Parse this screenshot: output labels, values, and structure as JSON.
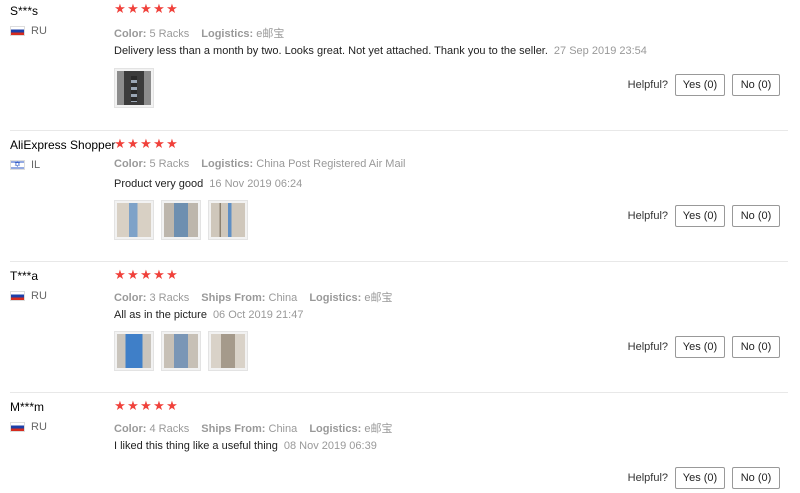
{
  "helpful_label": "Helpful?",
  "yes_label": "Yes (0)",
  "no_label": "No (0)",
  "star_glyph": "★",
  "rating_color": "#f0413b",
  "reviews": [
    {
      "name": "S***s",
      "country": "RU",
      "flag": "russia-flag",
      "stars": 5,
      "attributes": [
        {
          "key": "Color:",
          "value": "5 Racks"
        },
        {
          "key": "Logistics:",
          "value": "e邮宝"
        }
      ],
      "text": "Delivery less than a month by two. Looks great. Not yet attached. Thank you to the seller.",
      "date": "27 Sep 2019 23:54",
      "photo_count": 1
    },
    {
      "name": "AliExpress Shopper",
      "country": "IL",
      "flag": "israel-flag",
      "stars": 5,
      "attributes": [
        {
          "key": "Color:",
          "value": "5 Racks"
        },
        {
          "key": "Logistics:",
          "value": "China Post Registered Air Mail"
        }
      ],
      "text": "Product very good",
      "date": "16 Nov 2019 06:24",
      "photo_count": 3
    },
    {
      "name": "T***a",
      "country": "RU",
      "flag": "russia-flag",
      "stars": 5,
      "attributes": [
        {
          "key": "Color:",
          "value": "3 Racks"
        },
        {
          "key": "Ships From:",
          "value": "China"
        },
        {
          "key": "Logistics:",
          "value": "e邮宝"
        }
      ],
      "text": "All as in the picture",
      "date": "06 Oct 2019 21:47",
      "photo_count": 3
    },
    {
      "name": "M***m",
      "country": "RU",
      "flag": "russia-flag",
      "stars": 5,
      "attributes": [
        {
          "key": "Color:",
          "value": "4 Racks"
        },
        {
          "key": "Ships From:",
          "value": "China"
        },
        {
          "key": "Logistics:",
          "value": "e邮宝"
        }
      ],
      "text": "I liked this thing like a useful thing",
      "date": "08 Nov 2019 06:39",
      "photo_count": 0
    }
  ]
}
